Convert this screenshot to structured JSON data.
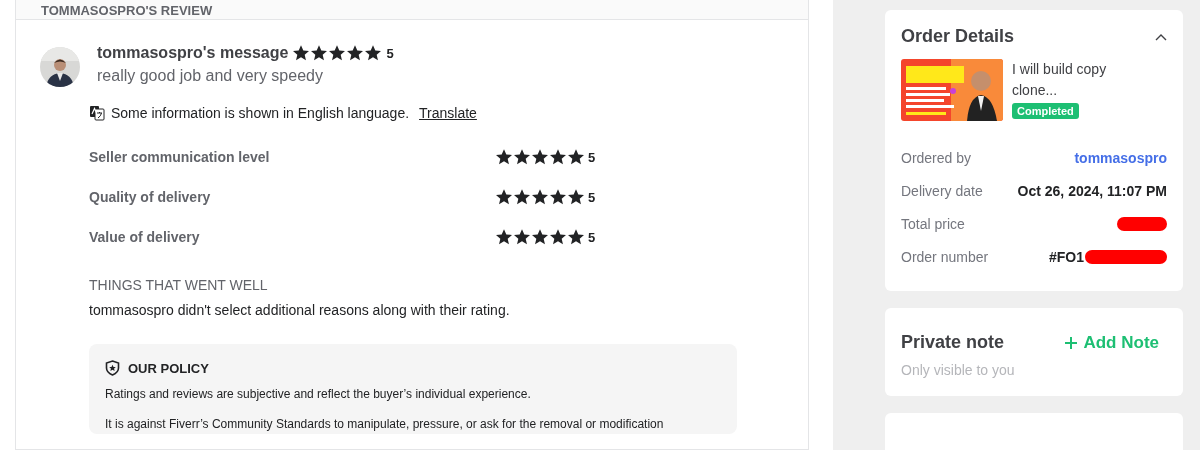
{
  "review": {
    "header": "TOMMASOSPRO'S REVIEW",
    "message": {
      "title": "tommasospro's message",
      "stars": 5,
      "rating": "5",
      "text": "really good job and very speedy"
    },
    "translate_notice": {
      "text": "Some information is shown in English language.",
      "link": "Translate"
    },
    "ratings": [
      {
        "label": "Seller communication level",
        "stars": 5,
        "rating": "5"
      },
      {
        "label": "Quality of delivery",
        "stars": 5,
        "rating": "5"
      },
      {
        "label": "Value of delivery",
        "stars": 5,
        "rating": "5"
      }
    ],
    "went_well": {
      "heading": "THINGS THAT WENT WELL",
      "text": "tommasospro didn't select additional reasons along with their rating."
    },
    "policy": {
      "heading": "OUR POLICY",
      "paragraphs": [
        "Ratings and reviews are subjective and reflect the buyer’s individual experience.",
        "It is against Fiverr’s Community Standards to manipulate, pressure, or ask for the removal or modification"
      ]
    }
  },
  "order_details": {
    "title": "Order Details",
    "expanded": true,
    "gig": {
      "title": "I will build copy clone...",
      "status": "Completed"
    },
    "rows": [
      {
        "label": "Ordered by",
        "value": "tommasospro",
        "kind": "link",
        "redacted": false
      },
      {
        "label": "Delivery date",
        "value": "Oct 26, 2024, 11:07 PM",
        "kind": "plain",
        "redacted": false
      },
      {
        "label": "Total price",
        "redacted": true
      },
      {
        "label": "Order number",
        "value": "#FO1",
        "kind": "plain",
        "redacted": true
      }
    ]
  },
  "private_note": {
    "title": "Private note",
    "hint": "Only visible to you",
    "action": "Add Note"
  }
}
